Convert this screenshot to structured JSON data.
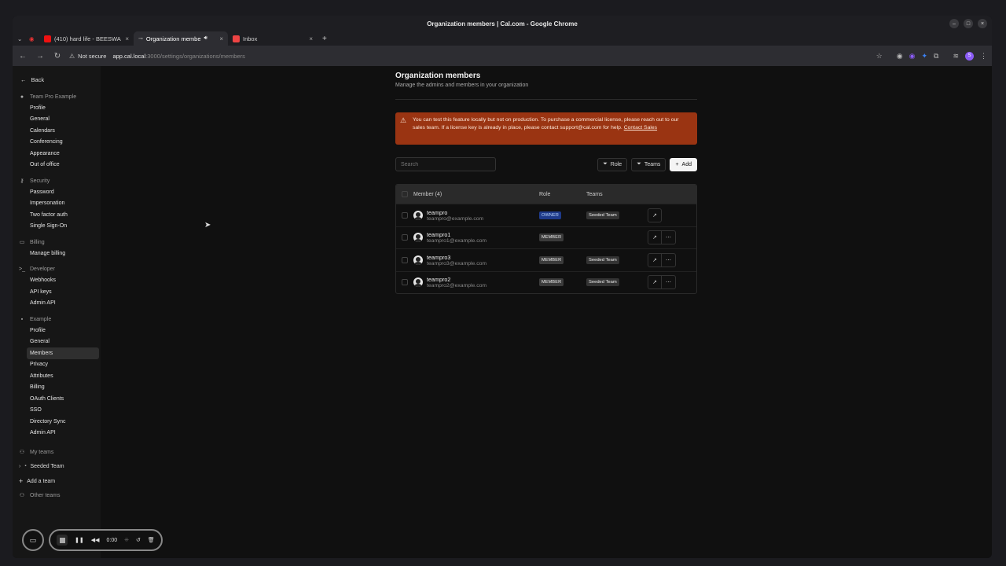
{
  "window": {
    "title": "Organization members | Cal.com - Google Chrome",
    "controls": [
      "–",
      "□",
      "×"
    ]
  },
  "tabs": [
    {
      "label": "(410) hard life - BEESWA",
      "icon": "youtube-icon"
    },
    {
      "label": "Organization membe",
      "icon": "calcom-icon"
    },
    {
      "label": "Inbox",
      "icon": "gmail-icon"
    }
  ],
  "address": {
    "security": "Not secure",
    "host": "app.cal.local",
    "path": ":3000/settings/organizations/members"
  },
  "sidebar": {
    "back": "Back",
    "team_pro": {
      "title": "Team Pro Example",
      "items": [
        "Profile",
        "General",
        "Calendars",
        "Conferencing",
        "Appearance",
        "Out of office"
      ]
    },
    "security": {
      "title": "Security",
      "items": [
        "Password",
        "Impersonation",
        "Two factor auth",
        "Single Sign-On"
      ]
    },
    "billing": {
      "title": "Billing",
      "items": [
        "Manage billing"
      ]
    },
    "developer": {
      "title": "Developer",
      "items": [
        "Webhooks",
        "API keys",
        "Admin API"
      ]
    },
    "org": {
      "title": "Example",
      "items": [
        "Profile",
        "General",
        "Members",
        "Privacy",
        "Attributes",
        "Billing",
        "OAuth Clients",
        "SSO",
        "Directory Sync",
        "Admin API"
      ]
    },
    "my_teams": "My teams",
    "seeded_team": "Seeded Team",
    "add_team": "Add a team",
    "other_teams": "Other teams"
  },
  "main": {
    "title": "Organization members",
    "subtitle": "Manage the admins and members in your organization",
    "alert_text": "You can test this feature locally but not on production. To purchase a commercial license, please reach out to our sales team. If a license key is already in place, please contact support@cal.com for help.",
    "alert_link": "Contact Sales",
    "search_placeholder": "Search",
    "filter_role": "Role",
    "filter_teams": "Teams",
    "add": "Add",
    "columns": {
      "member": "Member (4)",
      "role": "Role",
      "teams": "Teams"
    },
    "rows": [
      {
        "name": "teampro",
        "email": "teampro@example.com",
        "role": "OWNER",
        "team": "Seeded Team"
      },
      {
        "name": "teampro1",
        "email": "teampro1@example.com",
        "role": "MEMBER",
        "team": ""
      },
      {
        "name": "teampro3",
        "email": "teampro3@example.com",
        "role": "MEMBER",
        "team": "Seeded Team"
      },
      {
        "name": "teampro2",
        "email": "teampro2@example.com",
        "role": "MEMBER",
        "team": "Seeded Team"
      }
    ]
  },
  "recorder": {
    "time": "0:00"
  }
}
